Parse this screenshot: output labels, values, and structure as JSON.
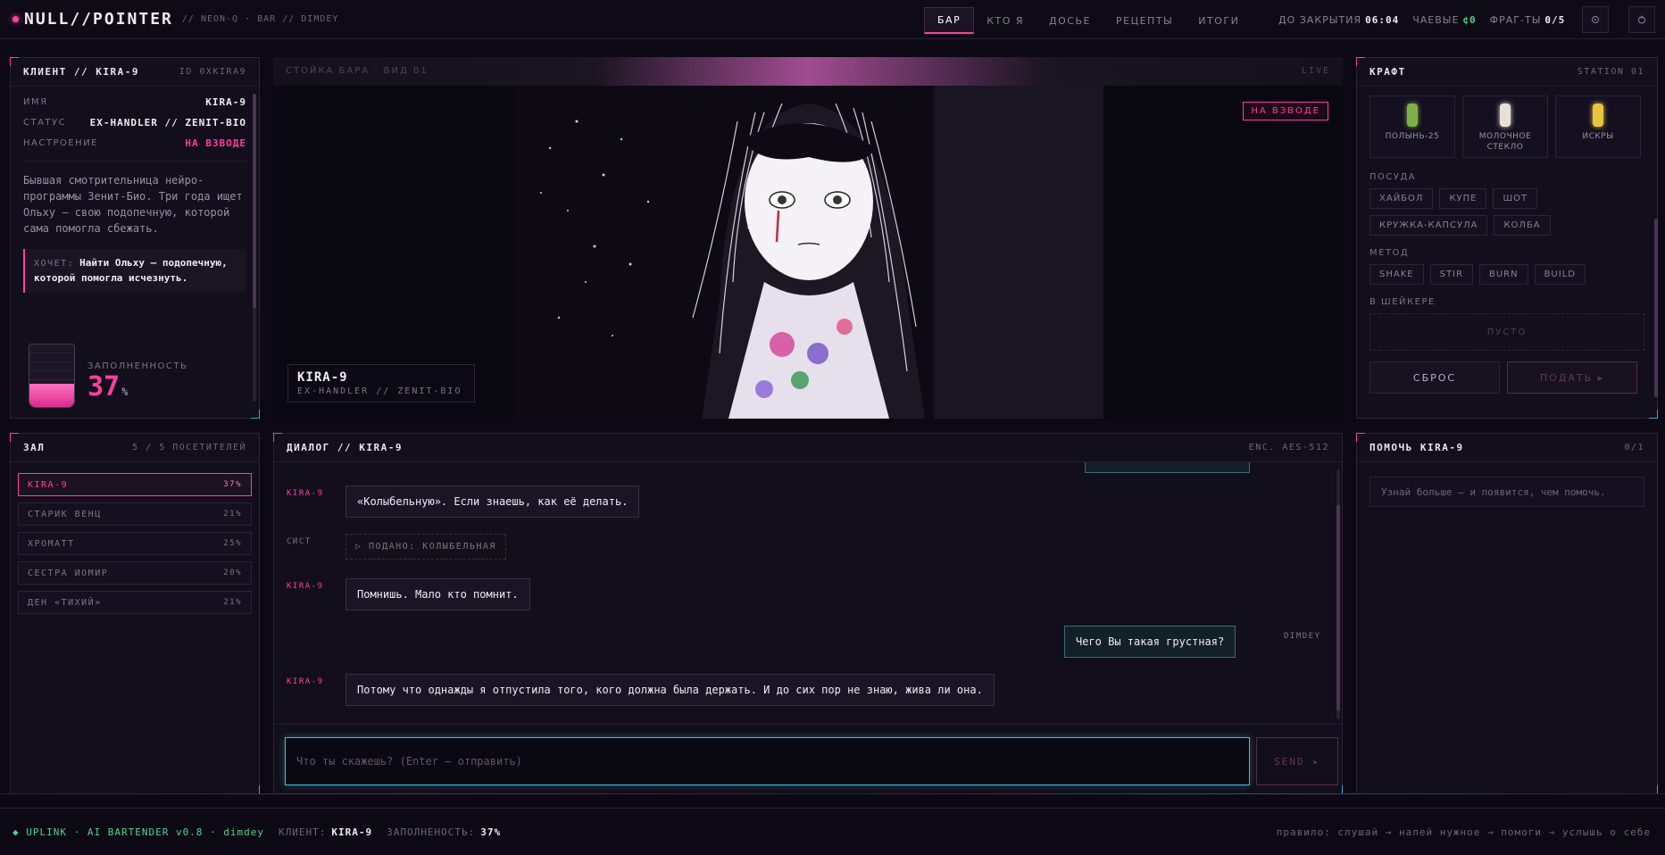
{
  "brand": {
    "name": "NULL//POINTER",
    "sub": "// NEON-Q · BAR // DIMDEY"
  },
  "nav": [
    "БАР",
    "КТО Я",
    "ДОСЬЕ",
    "РЕЦЕПТЫ",
    "ИТОГИ"
  ],
  "stats": {
    "close_label": "ДО ЗАКРЫТИЯ",
    "close_value": "06:04",
    "tips_label": "ЧАЕВЫЕ",
    "tips_value": "¢0",
    "frags_label": "ФРАГ-ТЫ",
    "frags_value": "0/5"
  },
  "icons": {
    "settings": "gear-icon",
    "power": "power-icon"
  },
  "client": {
    "title": "КЛИЕНТ // KIRA-9",
    "id": "ID 0XKIRA9",
    "name_label": "ИМЯ",
    "name_value": "KIRA-9",
    "status_label": "СТАТУС",
    "status_value": "EX-HANDLER // ZENIT-BIO",
    "mood_label": "НАСТРОЕНИЕ",
    "mood_value": "НА ВЗВОДЕ",
    "bio": "Бывшая смотрительница нейро-программы Зенит-Био. Три года ищет Ольху — свою подопечную, которой сама помогла сбежать.",
    "wants_label": "ХОЧЕТ:",
    "wants_value": "Найти Ольху — подопечную, которой помогла исчезнуть.",
    "fill_label": "ЗАПОЛНЕННОСТЬ",
    "fill_value": "37",
    "fill_unit": "%",
    "fill_fraction": 0.37
  },
  "scene": {
    "header_left": "СТОЙКА БАРА · ВИД 01",
    "header_right": "LIVE",
    "mood_tag": "НА ВЗВОДЕ",
    "plate_name": "KIRA-9",
    "plate_sub": "EX-HANDLER // ZENIT-BIO"
  },
  "craft": {
    "title": "КРАФТ",
    "station": "STATION 01",
    "ingredients": [
      {
        "name": "ПОЛЫНЬ-25",
        "color": "#7fb046"
      },
      {
        "name": "МОЛОЧНОЕ СТЕКЛО",
        "color": "#e8e0d4"
      },
      {
        "name": "ИСКРЫ",
        "color": "#e8c440"
      }
    ],
    "glass_label": "ПОСУДА",
    "glasses": [
      "ХАЙБОЛ",
      "КУПЕ",
      "ШОТ",
      "КРУЖКА-КАПСУЛА",
      "КОЛБА"
    ],
    "method_label": "МЕТОД",
    "methods": [
      "SHAKE",
      "STIR",
      "BURN",
      "BUILD"
    ],
    "shaker_label": "В ШЕЙКЕРЕ",
    "shaker_empty": "ПУСТО",
    "reset": "СБРОС",
    "serve": "ПОДАТЬ ▸"
  },
  "hall": {
    "title": "ЗАЛ",
    "count": "5 / 5 ПОСЕТИТЕЛЕЙ",
    "visitors": [
      {
        "name": "KIRA-9",
        "pct": "37%"
      },
      {
        "name": "СТАРИК ВЕНЦ",
        "pct": "21%"
      },
      {
        "name": "ХРОМАТТ",
        "pct": "25%"
      },
      {
        "name": "СЕСТРА ИОМИР",
        "pct": "20%"
      },
      {
        "name": "ДЕН «ТИХИЙ»",
        "pct": "21%"
      }
    ]
  },
  "dialog": {
    "title": "ДИАЛОГ // KIRA-9",
    "enc": "ENC. AES-512",
    "messages": [
      {
        "who": "KIRA-9",
        "text": "«Колыбельную». Если знаешь, как её делать."
      },
      {
        "who": "СИСТ",
        "text": "▷ ПОДАНО: КОЛЫБЕЛЬНАЯ"
      },
      {
        "who": "KIRA-9",
        "text": "Помнишь. Мало кто помнит."
      },
      {
        "who": "DIMDEY",
        "text": "Чего Вы такая грустная?"
      },
      {
        "who": "KIRA-9",
        "text": "Потому что однажды я отпустила того, кого должна была держать. И до сих пор не знаю, жива ли она."
      }
    ],
    "input_placeholder": "Что ты скажешь? (Enter — отправить)",
    "send": "SEND ▸"
  },
  "help": {
    "title": "ПОМОЧЬ KIRA-9",
    "count": "0/1",
    "hint": "Узнай больше — и появится, чем помочь."
  },
  "footer": {
    "uplink": "◆ UPLINK · AI BARTENDER v0.8 · dimdey",
    "client_label": "КЛИЕНТ:",
    "client_value": "KIRA-9",
    "fill_label": "ЗАПОЛНЕНОСТЬ:",
    "fill_value": "37%",
    "rule": "правило: слушай → налей нужное → помоги → услышь о себе"
  }
}
